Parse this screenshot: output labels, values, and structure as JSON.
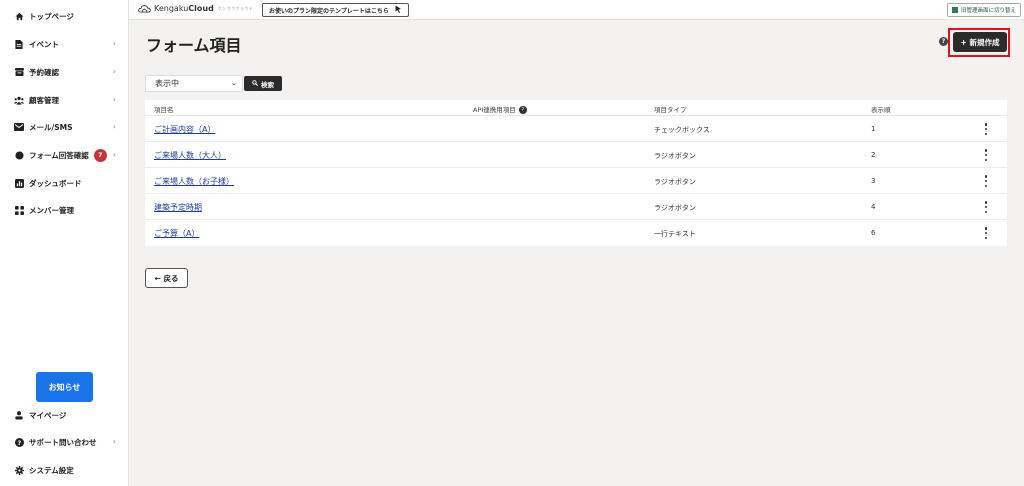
{
  "sidebar": {
    "items": [
      {
        "label": "トップページ",
        "chevron": false
      },
      {
        "label": "イベント",
        "chevron": true
      },
      {
        "label": "予約確認",
        "chevron": true
      },
      {
        "label": "顧客管理",
        "chevron": true
      },
      {
        "label": "メール/SMS",
        "chevron": true
      },
      {
        "label": "フォーム回答確認",
        "chevron": true,
        "badge": "7"
      },
      {
        "label": "ダッシュボード",
        "chevron": false
      },
      {
        "label": "メンバー管理",
        "chevron": false
      }
    ],
    "notice_label": "お知らせ",
    "bottom_items": [
      {
        "label": "マイページ",
        "chevron": false
      },
      {
        "label": "サポート問い合わせ",
        "chevron": true
      },
      {
        "label": "システム設定",
        "chevron": false
      }
    ],
    "chevron_glyph": "›"
  },
  "topbar": {
    "logo_light": "Kengaku",
    "logo_bold": "Cloud",
    "logo_tagline": "ケンガククラウド",
    "template_link": "お使いのプラン限定のテンプレートはこちら",
    "switch_label": "旧管理画面に切り替え"
  },
  "main": {
    "title": "フォーム項目",
    "new_button": "+ 新規作成",
    "filter_value": "表示中",
    "search_label": "検索",
    "back_label": "← 戻る"
  },
  "table": {
    "headers": {
      "name": "項目名",
      "api": "API連携用項目",
      "type": "項目タイプ",
      "order": "表示順"
    },
    "rows": [
      {
        "name": "ご計画内容（A）",
        "type": "チェックボックス",
        "order": "1"
      },
      {
        "name": "ご来場人数（大人）",
        "type": "ラジオボタン",
        "order": "2"
      },
      {
        "name": "ご来場人数（お子様）",
        "type": "ラジオボタン",
        "order": "3"
      },
      {
        "name": "建築予定時期",
        "type": "ラジオボタン",
        "order": "4"
      },
      {
        "name": "ご予算（A）",
        "type": "一行テキスト",
        "order": "6"
      }
    ]
  },
  "colors": {
    "accent_blue": "#1a73e8",
    "highlight_red": "#e0131c",
    "badge_red": "#c5343c",
    "dark_button": "#2b2b2b"
  }
}
